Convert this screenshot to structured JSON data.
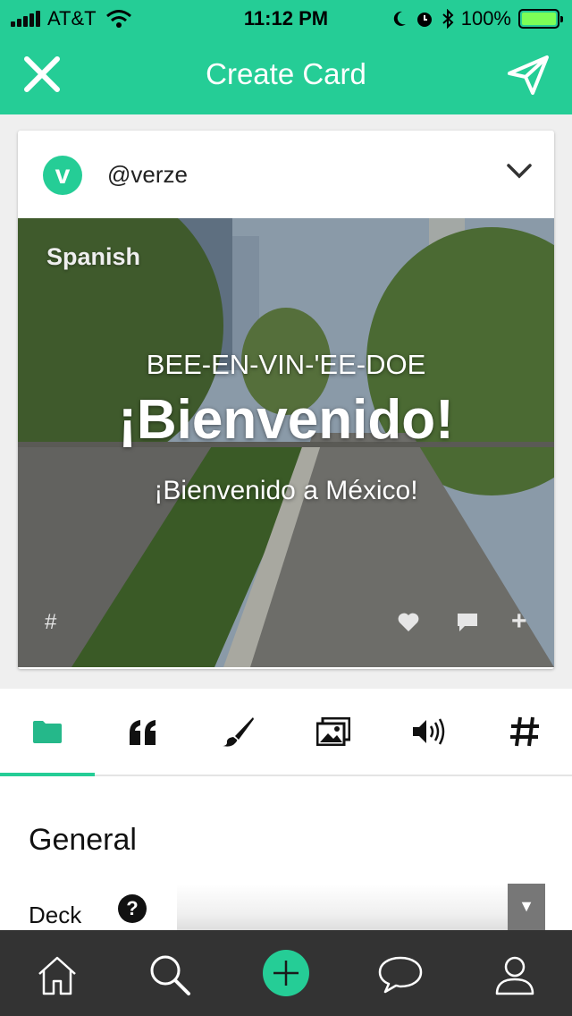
{
  "status_bar": {
    "carrier": "AT&T",
    "time": "11:12 PM",
    "battery": "100%",
    "icons": [
      "signal-icon",
      "wifi-icon",
      "moon-icon",
      "alarm-icon",
      "bluetooth-icon",
      "battery-icon"
    ]
  },
  "nav": {
    "title": "Create Card",
    "left_icon": "close-icon",
    "right_icon": "send-icon"
  },
  "card": {
    "username": "@verze",
    "avatar_letter": "v",
    "language": "Spanish",
    "pronunciation": "BEE-EN-VIN-'EE-DOE",
    "word": "¡Bienvenido!",
    "sentence": "¡Bienvenido a México!",
    "tag_symbol": "#",
    "plus_symbol": "+"
  },
  "tool_tabs": [
    {
      "icon": "folder-icon",
      "active": true
    },
    {
      "icon": "quote-icon",
      "active": false
    },
    {
      "icon": "brush-icon",
      "active": false
    },
    {
      "icon": "images-icon",
      "active": false
    },
    {
      "icon": "speaker-icon",
      "active": false
    },
    {
      "icon": "hashtag-icon",
      "active": false
    }
  ],
  "settings": {
    "title": "General",
    "deck_label": "Deck",
    "help_symbol": "?",
    "deck_value": ""
  },
  "tab_bar": [
    {
      "icon": "home-icon"
    },
    {
      "icon": "search-icon"
    },
    {
      "icon": "create-icon"
    },
    {
      "icon": "chat-icon"
    },
    {
      "icon": "profile-icon"
    }
  ],
  "colors": {
    "accent": "#25cd96",
    "tab_bar": "#333333"
  }
}
